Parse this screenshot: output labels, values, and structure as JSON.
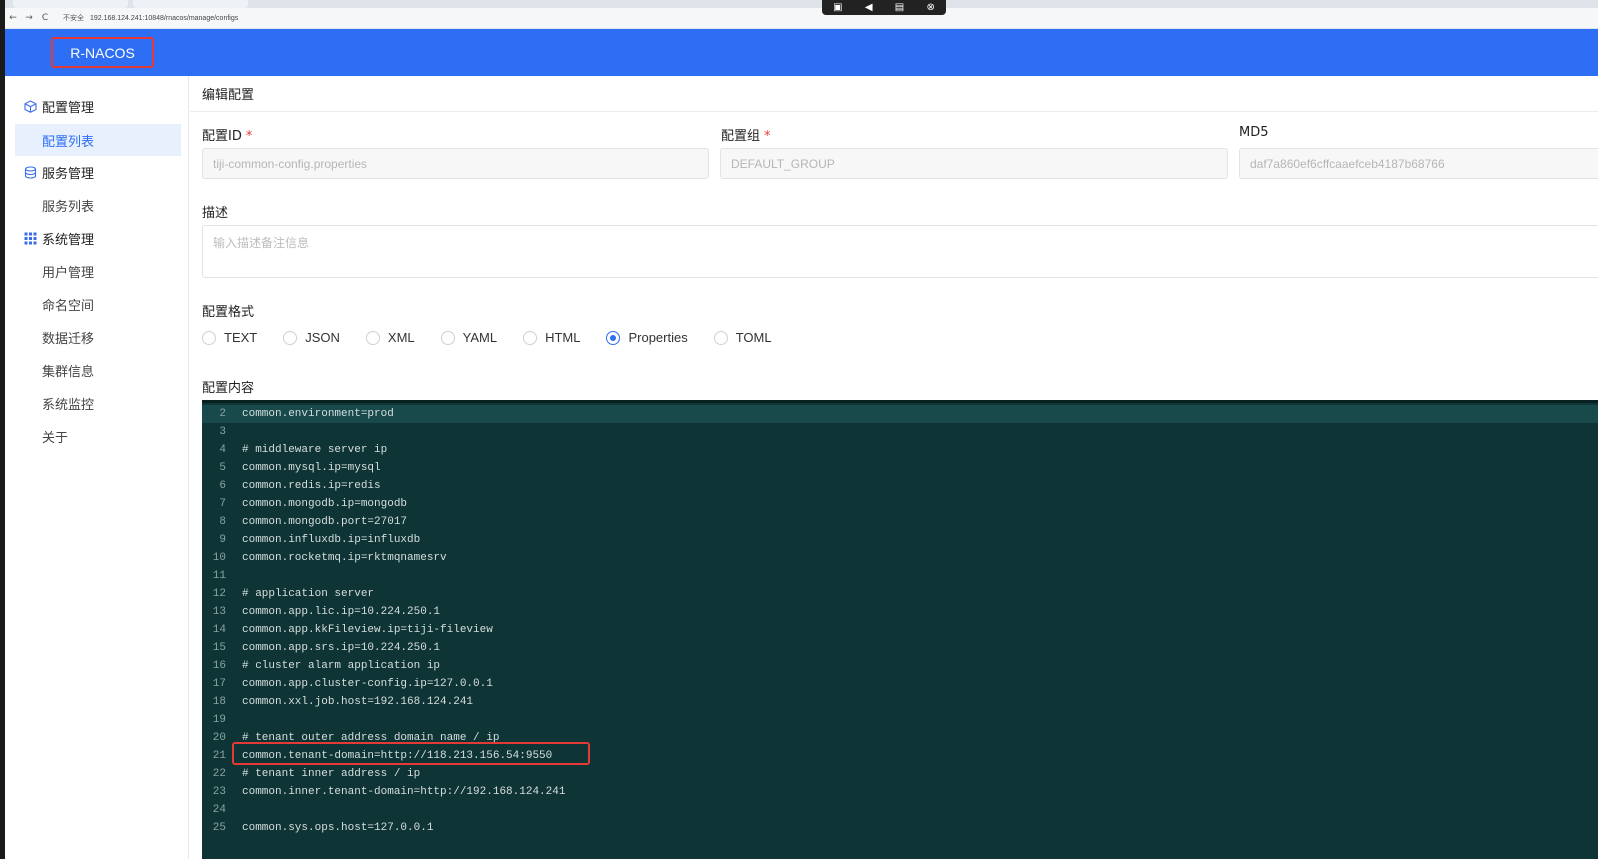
{
  "browser": {
    "url": "192.168.124.241:10848/rnacos/manage/configs",
    "security_label": "不安全",
    "nav_back": "←",
    "nav_forward": "→",
    "nav_reload": "C"
  },
  "header": {
    "logo": "R-NACOS"
  },
  "sidebar": {
    "groups": [
      {
        "label": "配置管理",
        "items": [
          "配置列表"
        ]
      },
      {
        "label": "服务管理",
        "items": [
          "服务列表"
        ]
      },
      {
        "label": "系统管理",
        "items": [
          "用户管理",
          "命名空间",
          "数据迁移",
          "集群信息",
          "系统监控",
          "关于"
        ]
      }
    ],
    "active_item": "配置列表"
  },
  "page": {
    "title": "编辑配置",
    "config_id": {
      "label": "配置ID",
      "required": "*",
      "value": "tiji-common-config.properties"
    },
    "config_group": {
      "label": "配置组",
      "required": "*",
      "value": "DEFAULT_GROUP"
    },
    "md5": {
      "label": "MD5",
      "value": "daf7a860ef6cffcaaefceb4187b68766"
    },
    "description": {
      "label": "描述",
      "placeholder": "输入描述备注信息"
    },
    "format": {
      "label": "配置格式",
      "options": [
        "TEXT",
        "JSON",
        "XML",
        "YAML",
        "HTML",
        "Properties",
        "TOML"
      ],
      "selected": "Properties"
    },
    "content_label": "配置内容"
  },
  "editor": {
    "lines": [
      {
        "n": "2",
        "text": "common.environment=prod"
      },
      {
        "n": "3",
        "text": ""
      },
      {
        "n": "4",
        "text": "# middleware server ip"
      },
      {
        "n": "5",
        "text": "common.mysql.ip=mysql"
      },
      {
        "n": "6",
        "text": "common.redis.ip=redis"
      },
      {
        "n": "7",
        "text": "common.mongodb.ip=mongodb"
      },
      {
        "n": "8",
        "text": "common.mongodb.port=27017"
      },
      {
        "n": "9",
        "text": "common.influxdb.ip=influxdb"
      },
      {
        "n": "10",
        "text": "common.rocketmq.ip=rktmqnamesrv"
      },
      {
        "n": "11",
        "text": ""
      },
      {
        "n": "12",
        "text": "# application server"
      },
      {
        "n": "13",
        "text": "common.app.lic.ip=10.224.250.1"
      },
      {
        "n": "14",
        "text": "common.app.kkFileview.ip=tiji-fileview"
      },
      {
        "n": "15",
        "text": "common.app.srs.ip=10.224.250.1"
      },
      {
        "n": "16",
        "text": "# cluster alarm application ip"
      },
      {
        "n": "17",
        "text": "common.app.cluster-config.ip=127.0.0.1"
      },
      {
        "n": "18",
        "text": "common.xxl.job.host=192.168.124.241"
      },
      {
        "n": "19",
        "text": ""
      },
      {
        "n": "20",
        "text": "# tenant outer address domain name / ip"
      },
      {
        "n": "21",
        "text": "common.tenant-domain=http://118.213.156.54:9550"
      },
      {
        "n": "22",
        "text": "# tenant inner address / ip"
      },
      {
        "n": "23",
        "text": "common.inner.tenant-domain=http://192.168.124.241"
      },
      {
        "n": "24",
        "text": ""
      },
      {
        "n": "25",
        "text": "common.sys.ops.host=127.0.0.1"
      }
    ]
  }
}
